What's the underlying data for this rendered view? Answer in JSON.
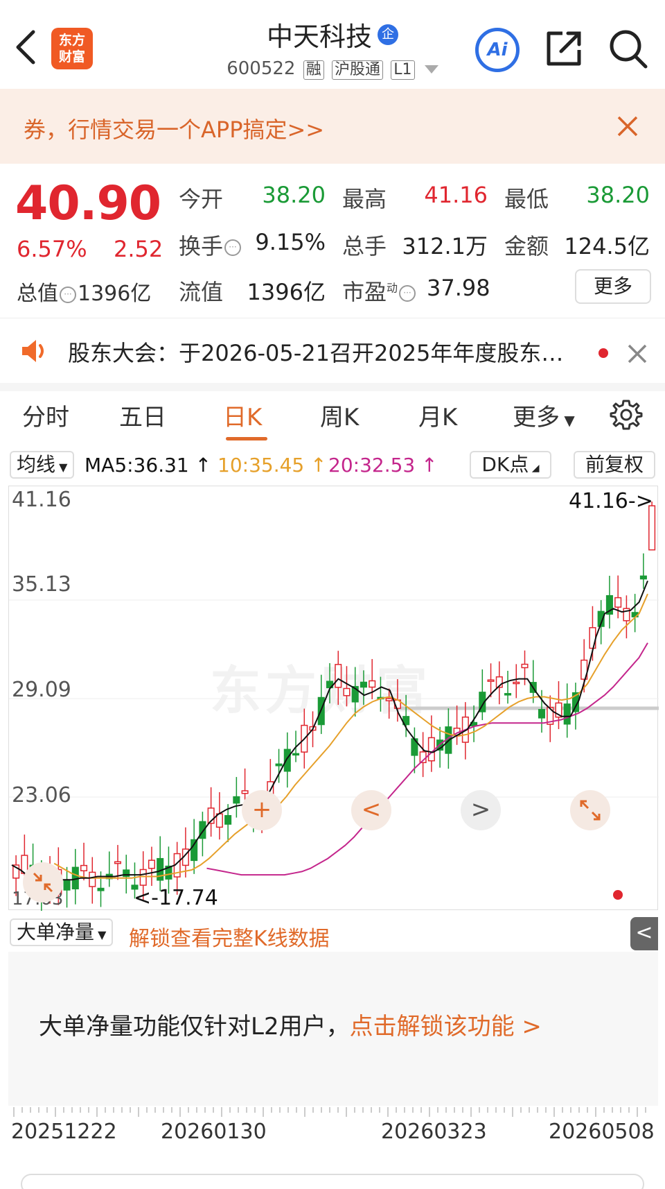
{
  "header": {
    "logo": [
      "东方",
      "财富"
    ],
    "stock_name": "中天科技",
    "enterprise_badge": "企",
    "stock_code": "600522",
    "tags": [
      "融",
      "沪股通",
      "L1"
    ],
    "ai_label": "Ai"
  },
  "banner": {
    "text": "券，行情交易一个APP搞定>>"
  },
  "quote": {
    "price": "40.90",
    "change_pct": "6.57%",
    "change_amt": "2.52",
    "total_cap_label": "总值",
    "total_cap_value": "1396亿",
    "open_label": "今开",
    "open_value": "38.20",
    "high_label": "最高",
    "high_value": "41.16",
    "low_label": "最低",
    "low_value": "38.20",
    "turnover_label": "换手",
    "turnover_value": "9.15%",
    "volume_label": "总手",
    "volume_value": "312.1万",
    "amount_label": "金额",
    "amount_value": "124.5亿",
    "float_cap_label": "流值",
    "float_cap_value": "1396亿",
    "pe_label": "市盈",
    "pe_sup": "动",
    "pe_value": "37.98",
    "more_label": "更多"
  },
  "notice": {
    "text": "股东大会：于2026-05-21召开2025年年度股东…"
  },
  "tabs": [
    "分时",
    "五日",
    "日K",
    "周K",
    "月K",
    "更多"
  ],
  "active_tab": "日K",
  "ma_bar": {
    "select_label": "均线",
    "ma5": "MA5:36.31",
    "ma10": "10:35.45",
    "ma20": "20:32.53",
    "arrow": "↑",
    "dk_label": "DK点",
    "fq_label": "前复权"
  },
  "colors": {
    "up": "#e0262f",
    "down": "#1a9a36",
    "ma5": "#111111",
    "ma10": "#e6a02a",
    "ma20": "#c4268c",
    "accent": "#e06a2a"
  },
  "chart": {
    "y_labels": [
      "41.16",
      "35.13",
      "29.09",
      "23.06",
      "17.03"
    ],
    "max_annotation": "41.16->",
    "min_annotation": "<-17.74",
    "watermark": "东方财富",
    "controls": [
      "+",
      "<",
      ">"
    ]
  },
  "chart_data": {
    "type": "candlestick",
    "ylim": [
      17.03,
      41.16
    ],
    "y_ticks": [
      41.16,
      35.13,
      29.09,
      23.06,
      17.03
    ],
    "x_ticks": [
      "20251222",
      "20260130",
      "20260323",
      "20260508"
    ],
    "ma5_close": [
      18.9,
      18.6,
      18.2,
      17.9,
      17.8,
      17.9,
      18.0,
      18.0,
      18.1,
      18.1,
      18.2,
      18.2,
      18.2,
      18.3,
      18.3,
      18.3,
      18.4,
      18.5,
      18.7,
      18.9,
      19.4,
      20.0,
      20.8,
      21.5,
      22.0,
      22.3,
      22.5,
      22.6,
      22.4,
      22.6,
      23.4,
      24.4,
      25.4,
      26.1,
      26.6,
      27.2,
      28.4,
      29.7,
      30.3,
      30.0,
      29.7,
      29.3,
      29.5,
      29.8,
      29.6,
      28.2,
      27.2,
      26.5,
      25.9,
      25.8,
      26.1,
      26.6,
      26.9,
      27.2,
      28.0,
      28.9,
      29.5,
      30.0,
      30.2,
      30.3,
      30.3,
      29.5,
      28.8,
      28.3,
      28.0,
      28.0,
      29.0,
      30.8,
      32.9,
      34.3,
      34.6,
      34.4,
      34.5,
      35.0,
      36.3
    ],
    "ma10_close": [
      19.0,
      18.7,
      18.4,
      18.2,
      18.1,
      18.1,
      18.1,
      18.1,
      18.1,
      18.1,
      18.2,
      18.2,
      18.2,
      18.3,
      18.4,
      18.5,
      18.6,
      18.9,
      19.3,
      19.8,
      20.3,
      20.8,
      21.2,
      21.6,
      21.9,
      22.1,
      22.5,
      23.1,
      23.8,
      24.4,
      25.0,
      25.6,
      26.2,
      26.9,
      27.6,
      28.2,
      28.6,
      28.9,
      29.1,
      29.2,
      29.0,
      28.6,
      28.2,
      27.8,
      27.4,
      27.1,
      26.9,
      26.8,
      26.9,
      27.1,
      27.4,
      27.8,
      28.2,
      28.6,
      28.9,
      29.1,
      29.2,
      29.2,
      29.1,
      29.0,
      29.1,
      29.4,
      30.0,
      30.9,
      31.8,
      32.6,
      33.3,
      33.8,
      34.3,
      35.5
    ],
    "ma20_close": [
      18.7,
      18.6,
      18.5,
      18.4,
      18.3,
      18.3,
      18.3,
      18.3,
      18.3,
      18.3,
      18.4,
      18.5,
      18.7,
      19.0,
      19.3,
      19.7,
      20.1,
      20.6,
      21.2,
      21.8,
      22.4,
      23.0,
      23.6,
      24.2,
      24.8,
      25.3,
      25.8,
      26.3,
      26.7,
      27.0,
      27.2,
      27.4,
      27.5,
      27.6,
      27.6,
      27.6,
      27.6,
      27.6,
      27.6,
      27.6,
      27.7,
      27.8,
      28.0,
      28.2,
      28.5,
      28.9,
      29.3,
      29.8,
      30.4,
      31.0,
      31.6,
      32.5
    ],
    "last_close": 40.9,
    "high": 41.16,
    "low": 17.74,
    "guide_level": 28.5
  },
  "net_volume": {
    "select_label": "大单净量",
    "unlock_text": "解锁查看完整K线数据",
    "collapse_icon": "<",
    "message_prefix": "大单净量功能仅针对L2用户，",
    "message_link": "点击解锁该功能 >"
  },
  "date_axis": [
    "20251222",
    "20260130",
    "20260323",
    "20260508"
  ]
}
